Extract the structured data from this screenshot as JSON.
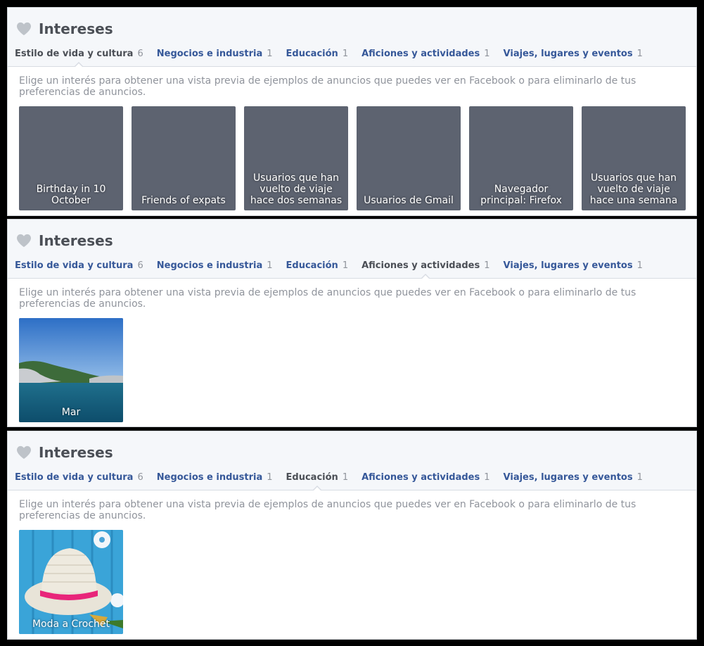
{
  "panels": [
    {
      "title": "Intereses",
      "active_tab": 0,
      "tabs": [
        {
          "label": "Estilo de vida y cultura",
          "count": "6"
        },
        {
          "label": "Negocios e industria",
          "count": "1"
        },
        {
          "label": "Educación",
          "count": "1"
        },
        {
          "label": "Aficiones y actividades",
          "count": "1"
        },
        {
          "label": "Viajes, lugares y eventos",
          "count": "1"
        }
      ],
      "description": "Elige un interés para obtener una vista previa de ejemplos de anuncios que puedes ver en Facebook o para eliminarlo de tus preferencias de anuncios.",
      "cards": [
        {
          "label": "Birthday in 10 October"
        },
        {
          "label": "Friends of expats"
        },
        {
          "label": "Usuarios que han vuelto de viaje hace dos semanas"
        },
        {
          "label": "Usuarios de Gmail"
        },
        {
          "label": "Navegador principal: Firefox"
        },
        {
          "label": "Usuarios que han vuelto de viaje hace una semana"
        }
      ]
    },
    {
      "title": "Intereses",
      "active_tab": 3,
      "tabs": [
        {
          "label": "Estilo de vida y cultura",
          "count": "6"
        },
        {
          "label": "Negocios e industria",
          "count": "1"
        },
        {
          "label": "Educación",
          "count": "1"
        },
        {
          "label": "Aficiones y actividades",
          "count": "1"
        },
        {
          "label": "Viajes, lugares y eventos",
          "count": "1"
        }
      ],
      "description": "Elige un interés para obtener una vista previa de ejemplos de anuncios que puedes ver en Facebook o para eliminarlo de tus preferencias de anuncios.",
      "cards": [
        {
          "label": "Mar",
          "image": "sea-photo"
        }
      ]
    },
    {
      "title": "Intereses",
      "active_tab": 2,
      "tabs": [
        {
          "label": "Estilo de vida y cultura",
          "count": "6"
        },
        {
          "label": "Negocios e industria",
          "count": "1"
        },
        {
          "label": "Educación",
          "count": "1"
        },
        {
          "label": "Aficiones y actividades",
          "count": "1"
        },
        {
          "label": "Viajes, lugares y eventos",
          "count": "1"
        }
      ],
      "description": "Elige un interés para obtener una vista previa de ejemplos de anuncios que puedes ver en Facebook o para eliminarlo de tus preferencias de anuncios.",
      "cards": [
        {
          "label": "Moda a Crochet",
          "image": "crochet-hat-photo"
        }
      ]
    }
  ],
  "colors": {
    "link": "#365899",
    "active_tab": "#4b4f56",
    "muted": "#90949c",
    "card_bg": "#5d6370",
    "heart": "#bec3c9"
  },
  "icons": {
    "title": "heart-icon"
  }
}
